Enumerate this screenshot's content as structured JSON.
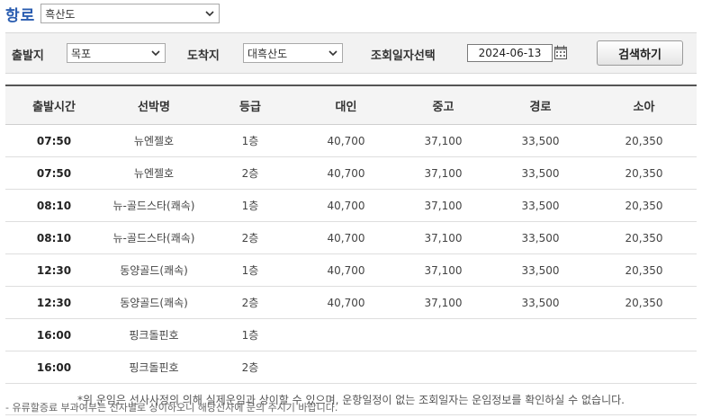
{
  "route": {
    "label": "항로",
    "selected": "흑산도"
  },
  "search": {
    "departure_label": "출발지",
    "departure_value": "목포",
    "arrival_label": "도착지",
    "arrival_value": "대흑산도",
    "date_label": "조회일자선택",
    "date_value": "2024-06-13",
    "button_label": "검색하기"
  },
  "table": {
    "headers": [
      "출발시간",
      "선박명",
      "등급",
      "대인",
      "중고",
      "경로",
      "소아"
    ],
    "rows": [
      [
        "07:50",
        "뉴엔젤호",
        "1층",
        "40,700",
        "37,100",
        "33,500",
        "20,350"
      ],
      [
        "07:50",
        "뉴엔젤호",
        "2층",
        "40,700",
        "37,100",
        "33,500",
        "20,350"
      ],
      [
        "08:10",
        "뉴-골드스타(쾌속)",
        "1층",
        "40,700",
        "37,100",
        "33,500",
        "20,350"
      ],
      [
        "08:10",
        "뉴-골드스타(쾌속)",
        "2층",
        "40,700",
        "37,100",
        "33,500",
        "20,350"
      ],
      [
        "12:30",
        "동양골드(쾌속)",
        "1층",
        "40,700",
        "37,100",
        "33,500",
        "20,350"
      ],
      [
        "12:30",
        "동양골드(쾌속)",
        "2층",
        "40,700",
        "37,100",
        "33,500",
        "20,350"
      ],
      [
        "16:00",
        "핑크돌핀호",
        "1층",
        "",
        "",
        "",
        ""
      ],
      [
        "16:00",
        "핑크돌핀호",
        "2층",
        "",
        "",
        "",
        ""
      ]
    ],
    "note": "*위 운임은 선사사정의 의해 실제운임과 상이할 수 있으며, 운항일정이 없는 조회일자는 운임정보를 확인하실 수 없습니다."
  },
  "footnote": "- 유류할증료 부과여부는 선사별로 상이하오니 해당선사에 문의 주시기 바랍니다.",
  "colors": {
    "route_label": "#2a5db0",
    "panel_bg": "#f2f2f2",
    "header_bg": "#f4f4f4"
  },
  "icons": [
    "chevron-down-icon",
    "calendar-icon"
  ]
}
